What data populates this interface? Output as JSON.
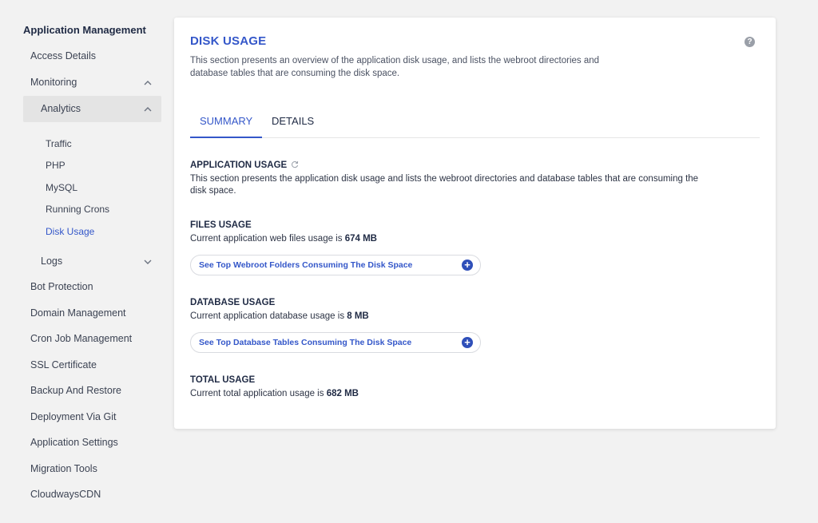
{
  "sidebar": {
    "title": "Application Management",
    "access_details": "Access Details",
    "monitoring": "Monitoring",
    "analytics": "Analytics",
    "analytics_items": [
      "Traffic",
      "PHP",
      "MySQL",
      "Running Crons",
      "Disk Usage"
    ],
    "logs": "Logs",
    "items": [
      "Bot Protection",
      "Domain Management",
      "Cron Job Management",
      "SSL Certificate",
      "Backup And Restore",
      "Deployment Via Git",
      "Application Settings",
      "Migration Tools",
      "CloudwaysCDN"
    ]
  },
  "card": {
    "title": "DISK USAGE",
    "help": "?",
    "description": "This section presents an overview of the application disk usage, and lists the webroot directories and database tables that are consuming the disk space.",
    "tabs": [
      "SUMMARY",
      "DETAILS"
    ],
    "application_usage": {
      "heading": "APPLICATION USAGE",
      "text": "This section presents the application disk usage and lists the webroot directories and database tables that are consuming the disk space."
    },
    "files_usage": {
      "heading": "FILES USAGE",
      "text": "Current application web files usage is ",
      "value": "674 MB",
      "button": "See Top Webroot Folders Consuming The Disk Space"
    },
    "database_usage": {
      "heading": "DATABASE USAGE",
      "text": "Current application database usage is ",
      "value": "8 MB",
      "button": "See Top Database Tables Consuming The Disk Space"
    },
    "total_usage": {
      "heading": "TOTAL USAGE",
      "text": "Current total application usage is ",
      "value": "682 MB"
    }
  },
  "colors": {
    "accent": "#3457c9",
    "background": "#f2f2f2",
    "active_row": "#e4e4e4"
  },
  "icons": [
    "chevron-up-icon",
    "chevron-down-icon",
    "help-icon",
    "refresh-icon",
    "plus-circle-icon"
  ]
}
